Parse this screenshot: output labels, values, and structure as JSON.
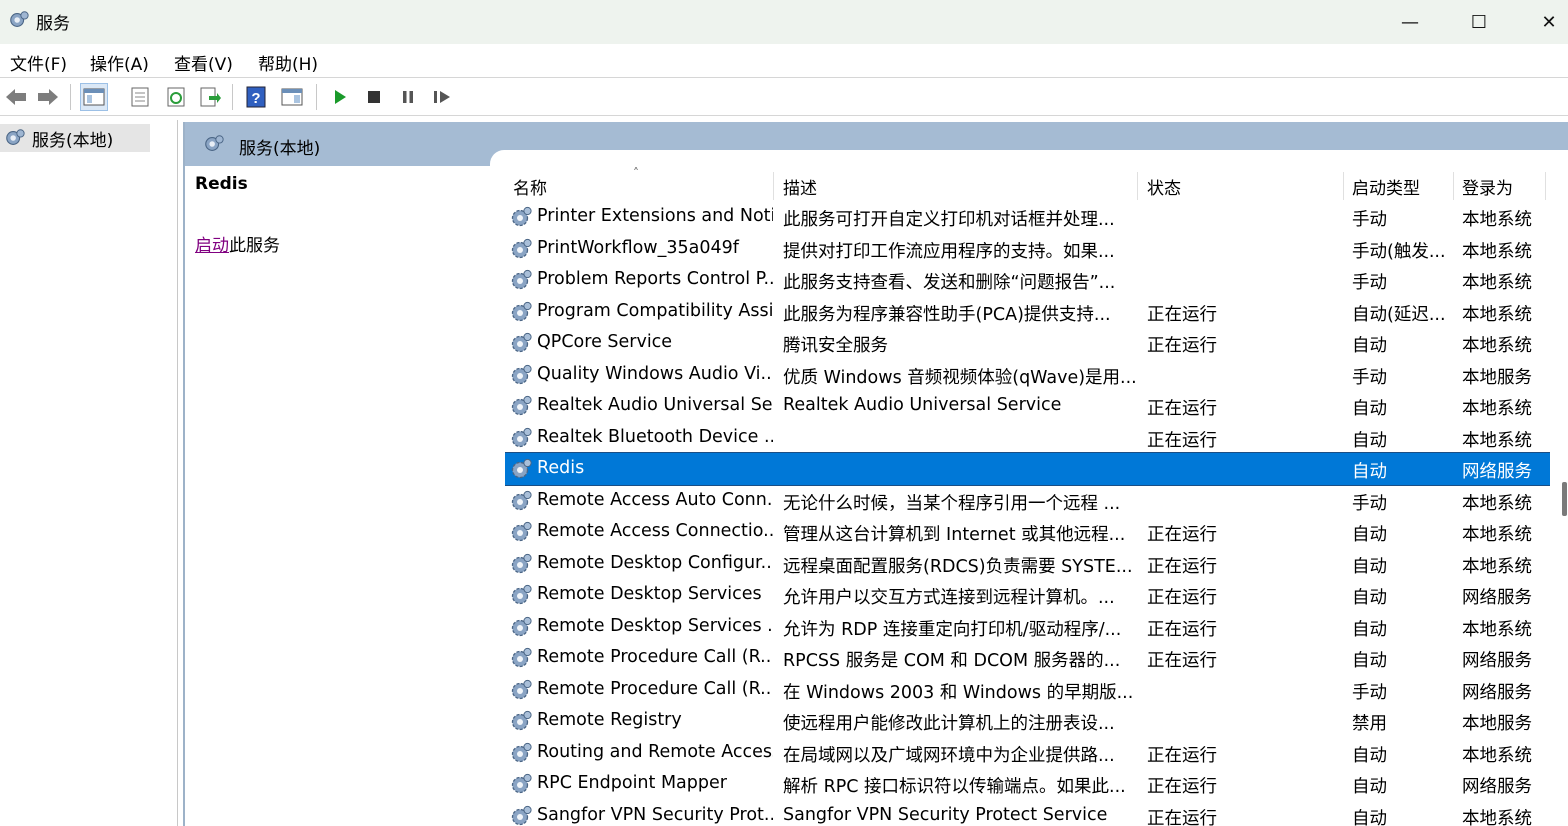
{
  "window": {
    "title": "服务",
    "minimize": "—",
    "maximize": "☐",
    "close": "✕"
  },
  "menu": [
    "文件(F)",
    "操作(A)",
    "查看(V)",
    "帮助(H)"
  ],
  "toolbar": {
    "buttons": [
      "back-icon",
      "forward-icon",
      "show-hide-tree-icon",
      "properties-icon",
      "refresh-icon",
      "export-list-icon",
      "help-icon",
      "show-hide-action-pane-icon",
      "start-service-icon",
      "stop-service-icon",
      "pause-service-icon",
      "resume-service-icon"
    ]
  },
  "tree": {
    "root_label": "服务(本地)"
  },
  "pane": {
    "header_title": "服务(本地)",
    "selected_service": "Redis",
    "action_link": "启动",
    "action_suffix": "此服务"
  },
  "columns": {
    "name": "名称",
    "desc": "描述",
    "state": "状态",
    "startup": "启动类型",
    "logon": "登录为"
  },
  "services": [
    {
      "name": "Printer Extensions and Noti...",
      "desc": "此服务可打开自定义打印机对话框并处理...",
      "state": "",
      "startup": "手动",
      "logon": "本地系统"
    },
    {
      "name": "PrintWorkflow_35a049f",
      "desc": "提供对打印工作流应用程序的支持。如果...",
      "state": "",
      "startup": "手动(触发...",
      "logon": "本地系统"
    },
    {
      "name": "Problem Reports Control P...",
      "desc": "此服务支持查看、发送和删除“问题报告”...",
      "state": "",
      "startup": "手动",
      "logon": "本地系统"
    },
    {
      "name": "Program Compatibility Assi...",
      "desc": "此服务为程序兼容性助手(PCA)提供支持...",
      "state": "正在运行",
      "startup": "自动(延迟...",
      "logon": "本地系统"
    },
    {
      "name": "QPCore Service",
      "desc": "腾讯安全服务",
      "state": "正在运行",
      "startup": "自动",
      "logon": "本地系统"
    },
    {
      "name": "Quality Windows Audio Vi...",
      "desc": "优质 Windows 音频视频体验(qWave)是用...",
      "state": "",
      "startup": "手动",
      "logon": "本地服务"
    },
    {
      "name": "Realtek Audio Universal Service",
      "desc": "Realtek Audio Universal Service",
      "state": "正在运行",
      "startup": "自动",
      "logon": "本地系统"
    },
    {
      "name": "Realtek Bluetooth Device ...",
      "desc": "",
      "state": "正在运行",
      "startup": "自动",
      "logon": "本地系统"
    },
    {
      "name": "Redis",
      "desc": "",
      "state": "",
      "startup": "自动",
      "logon": "网络服务",
      "selected": true
    },
    {
      "name": "Remote Access Auto Conn...",
      "desc": "无论什么时候，当某个程序引用一个远程 ...",
      "state": "",
      "startup": "手动",
      "logon": "本地系统"
    },
    {
      "name": "Remote Access Connectio...",
      "desc": "管理从这台计算机到 Internet 或其他远程...",
      "state": "正在运行",
      "startup": "自动",
      "logon": "本地系统"
    },
    {
      "name": "Remote Desktop Configur...",
      "desc": "远程桌面配置服务(RDCS)负责需要 SYSTE...",
      "state": "正在运行",
      "startup": "自动",
      "logon": "本地系统"
    },
    {
      "name": "Remote Desktop Services",
      "desc": "允许用户以交互方式连接到远程计算机。...",
      "state": "正在运行",
      "startup": "自动",
      "logon": "网络服务"
    },
    {
      "name": "Remote Desktop Services ...",
      "desc": "允许为 RDP 连接重定向打印机/驱动程序/...",
      "state": "正在运行",
      "startup": "自动",
      "logon": "本地系统"
    },
    {
      "name": "Remote Procedure Call (R...",
      "desc": "RPCSS 服务是 COM 和 DCOM 服务器的...",
      "state": "正在运行",
      "startup": "自动",
      "logon": "网络服务"
    },
    {
      "name": "Remote Procedure Call (R...",
      "desc": "在 Windows 2003 和 Windows 的早期版...",
      "state": "",
      "startup": "手动",
      "logon": "网络服务"
    },
    {
      "name": "Remote Registry",
      "desc": "使远程用户能修改此计算机上的注册表设...",
      "state": "",
      "startup": "禁用",
      "logon": "本地服务"
    },
    {
      "name": "Routing and Remote Access",
      "desc": "在局域网以及广域网环境中为企业提供路...",
      "state": "正在运行",
      "startup": "自动",
      "logon": "本地系统"
    },
    {
      "name": "RPC Endpoint Mapper",
      "desc": "解析 RPC 接口标识符以传输端点。如果此...",
      "state": "正在运行",
      "startup": "自动",
      "logon": "网络服务"
    },
    {
      "name": "Sangfor VPN Security Prot...",
      "desc": "Sangfor VPN Security Protect Service",
      "state": "正在运行",
      "startup": "自动",
      "logon": "本地系统"
    }
  ]
}
